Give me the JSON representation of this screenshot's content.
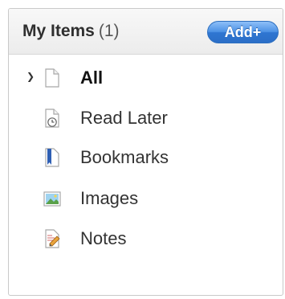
{
  "header": {
    "title": "My Items",
    "count": "(1)",
    "add_button": "Add+"
  },
  "items": [
    {
      "label": "All",
      "icon": "document-icon",
      "active": true
    },
    {
      "label": "Read Later",
      "icon": "clock-icon"
    },
    {
      "label": "Bookmarks",
      "icon": "bookmark-icon"
    },
    {
      "label": "Images",
      "icon": "image-icon"
    },
    {
      "label": "Notes",
      "icon": "notes-icon"
    }
  ]
}
